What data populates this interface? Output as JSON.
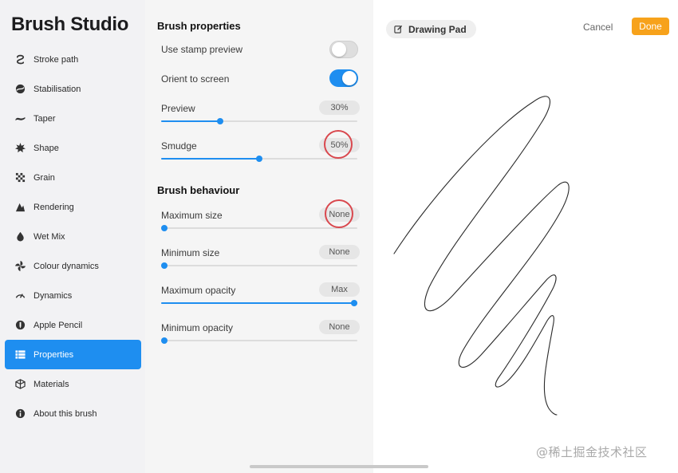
{
  "app": {
    "title": "Brush Studio"
  },
  "sidebar": {
    "items": [
      {
        "label": "Stroke path",
        "icon": "stroke-path-icon",
        "active": false
      },
      {
        "label": "Stabilisation",
        "icon": "stabilisation-icon",
        "active": false
      },
      {
        "label": "Taper",
        "icon": "taper-icon",
        "active": false
      },
      {
        "label": "Shape",
        "icon": "shape-icon",
        "active": false
      },
      {
        "label": "Grain",
        "icon": "grain-icon",
        "active": false
      },
      {
        "label": "Rendering",
        "icon": "rendering-icon",
        "active": false
      },
      {
        "label": "Wet Mix",
        "icon": "wet-mix-icon",
        "active": false
      },
      {
        "label": "Colour dynamics",
        "icon": "colour-dynamics-icon",
        "active": false
      },
      {
        "label": "Dynamics",
        "icon": "dynamics-icon",
        "active": false
      },
      {
        "label": "Apple Pencil",
        "icon": "apple-pencil-icon",
        "active": false
      },
      {
        "label": "Properties",
        "icon": "properties-icon",
        "active": true
      },
      {
        "label": "Materials",
        "icon": "materials-icon",
        "active": false
      },
      {
        "label": "About this brush",
        "icon": "about-icon",
        "active": false
      }
    ]
  },
  "properties": {
    "title": "Brush properties",
    "use_stamp_preview": {
      "label": "Use stamp preview",
      "on": false
    },
    "orient_to_screen": {
      "label": "Orient to screen",
      "on": true
    },
    "preview": {
      "label": "Preview",
      "value": "30%",
      "level": 0.3
    },
    "smudge": {
      "label": "Smudge",
      "value": "50%",
      "level": 0.5
    }
  },
  "behaviour": {
    "title": "Brush behaviour",
    "maximum_size": {
      "label": "Maximum size",
      "value": "None",
      "level": 0.0
    },
    "minimum_size": {
      "label": "Minimum size",
      "value": "None",
      "level": 0.0
    },
    "maximum_opacity": {
      "label": "Maximum opacity",
      "value": "Max",
      "level": 1.0
    },
    "minimum_opacity": {
      "label": "Minimum opacity",
      "value": "None",
      "level": 0.0
    }
  },
  "canvas": {
    "pad_label": "Drawing Pad",
    "cancel_label": "Cancel",
    "done_label": "Done"
  },
  "watermark": "@稀土掘金技术社区",
  "colors": {
    "accent": "#1e8ef0",
    "done": "#f7a21b",
    "annotation": "#d9484e"
  }
}
